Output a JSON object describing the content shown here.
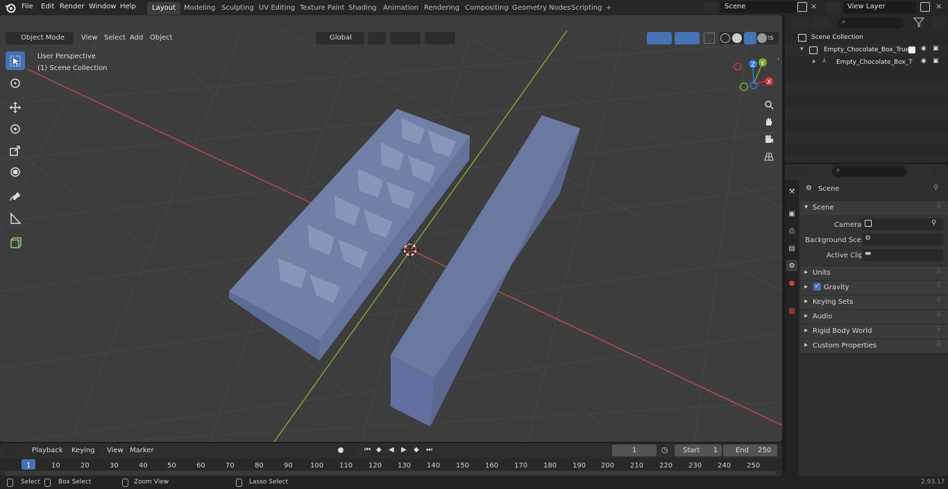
{
  "menu": {
    "file": "File",
    "edit": "Edit",
    "render": "Render",
    "window": "Window",
    "help": "Help"
  },
  "workspaces": [
    "Layout",
    "Modeling",
    "Sculpting",
    "UV Editing",
    "Texture Paint",
    "Shading",
    "Animation",
    "Rendering",
    "Compositing",
    "Geometry Nodes",
    "Scripting"
  ],
  "topbar": {
    "scene": "Scene",
    "view_layer": "View Layer",
    "add_tab": "+"
  },
  "viewport_header": {
    "mode": "Object Mode",
    "view": "View",
    "select": "Select",
    "add": "Add",
    "object": "Object",
    "orientation": "Global",
    "options": "Options"
  },
  "viewport_overlay": {
    "perspective": "User Perspective",
    "collection": "(1) Scene Collection"
  },
  "gizmo": {
    "x": "X",
    "y": "Y",
    "z": "Z"
  },
  "outliner": {
    "root": "Scene Collection",
    "items": [
      {
        "label": "Empty_Chocolate_Box_True_"
      },
      {
        "label": "Empty_Chocolate_Box_T"
      }
    ]
  },
  "properties": {
    "context": "Scene",
    "panel": "Scene",
    "camera_label": "Camera",
    "bg_scene_label": "Background Scene",
    "active_clip_label": "Active Clip",
    "sections": [
      "Units",
      "Gravity",
      "Keying Sets",
      "Audio",
      "Rigid Body World",
      "Custom Properties"
    ]
  },
  "timeline": {
    "playback": "Playback",
    "keying": "Keying",
    "view": "View",
    "marker": "Marker",
    "current_frame": "1",
    "start_label": "Start",
    "start": "1",
    "end_label": "End",
    "end": "250",
    "ruler": [
      "1",
      "10",
      "20",
      "30",
      "40",
      "50",
      "60",
      "70",
      "80",
      "90",
      "100",
      "110",
      "120",
      "130",
      "140",
      "150",
      "160",
      "170",
      "180",
      "190",
      "200",
      "210",
      "220",
      "230",
      "240",
      "250"
    ]
  },
  "statusbar": {
    "select": "Select",
    "box_select": "Box Select",
    "zoom_view": "Zoom View",
    "lasso_select": "Lasso Select",
    "version": "2.93.17"
  }
}
